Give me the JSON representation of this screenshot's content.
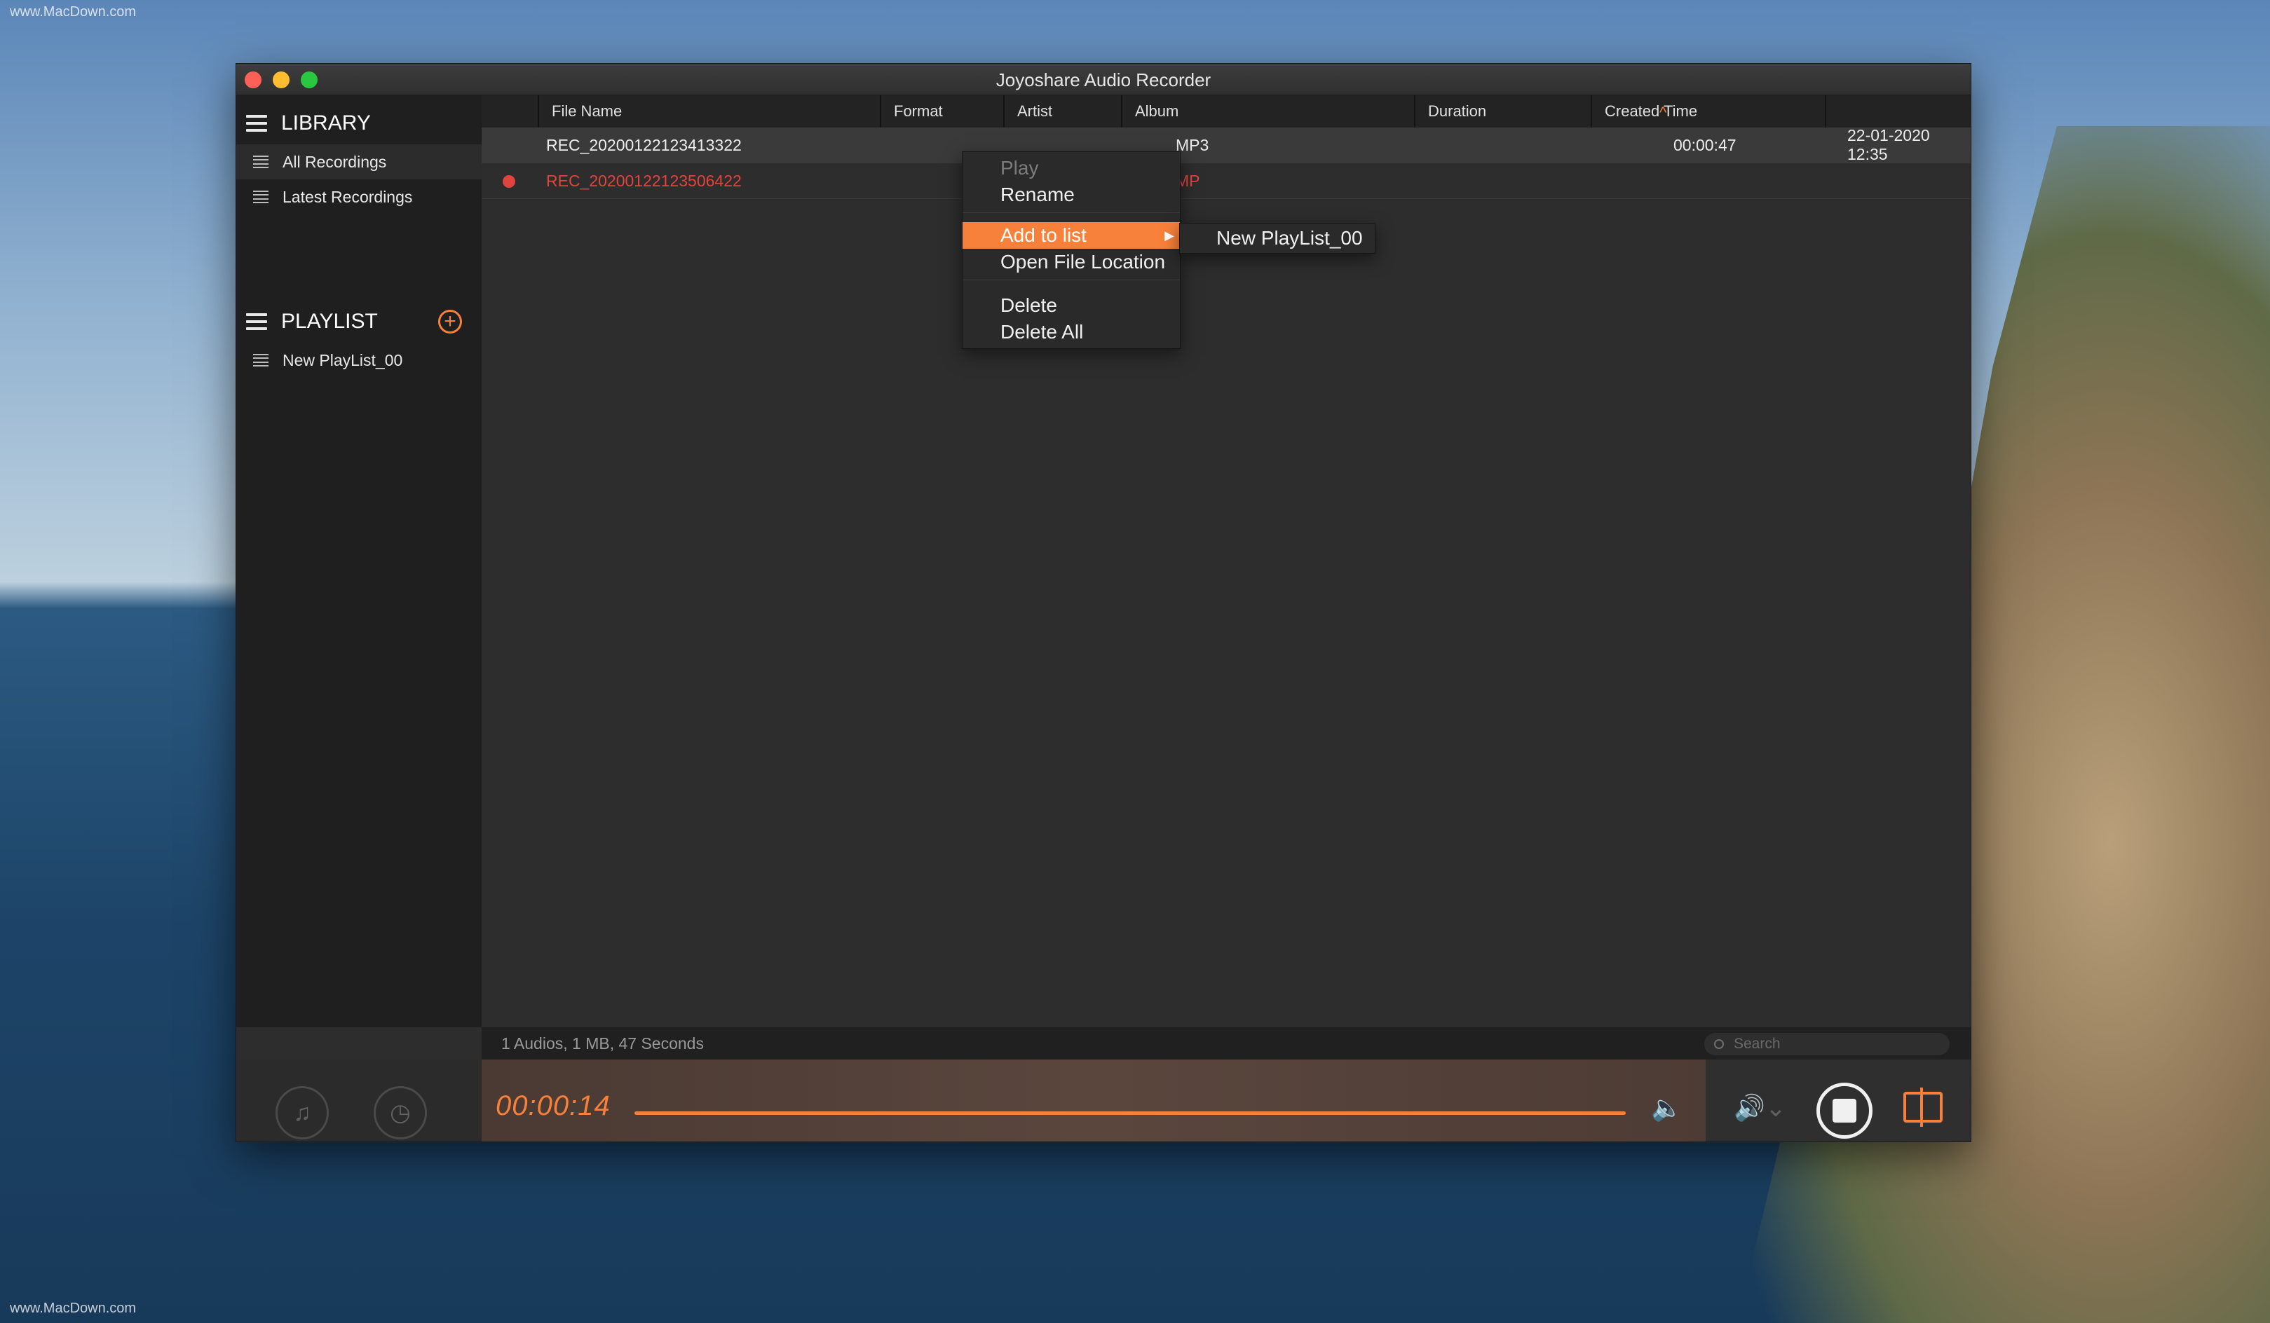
{
  "watermark": {
    "text": "www.MacDown.com"
  },
  "window": {
    "title": "Joyoshare Audio Recorder"
  },
  "sidebar": {
    "library_label": "LIBRARY",
    "library_items": [
      {
        "label": "All Recordings"
      },
      {
        "label": "Latest Recordings"
      }
    ],
    "playlist_label": "PLAYLIST",
    "playlist_items": [
      {
        "label": "New PlayList_00"
      }
    ]
  },
  "table": {
    "columns": [
      "File Name",
      "Format",
      "Artist",
      "Album",
      "Duration",
      "Created Time"
    ],
    "sort_column": "Album",
    "rows": [
      {
        "file_name": "REC_20200122123413322",
        "format": "MP3",
        "artist": "",
        "album": "",
        "duration": "00:00:47",
        "created": "22-01-2020 12:35",
        "recording": false
      },
      {
        "file_name": "REC_20200122123506422",
        "format": "MP",
        "artist": "",
        "album": "",
        "duration": "",
        "created": "",
        "recording": true
      }
    ]
  },
  "context_menu": {
    "items": [
      {
        "label": "Play",
        "disabled": true
      },
      {
        "label": "Rename"
      },
      {
        "label": "Add to list",
        "highlighted": true,
        "submenu": true
      },
      {
        "label": "Open File Location"
      },
      {
        "label": "Delete"
      },
      {
        "label": "Delete All"
      }
    ],
    "submenu_items": [
      "New PlayList_00"
    ]
  },
  "status": {
    "summary": "1 Audios, 1 MB, 47 Seconds"
  },
  "search": {
    "placeholder": "Search"
  },
  "player": {
    "timer": "00:00:14",
    "progress": 1.0,
    "icons": [
      "music-library-icon",
      "alarm-clock-icon",
      "volume-icon",
      "speaker-icon",
      "stop-icon",
      "split-icon"
    ]
  },
  "colors": {
    "accent": "#f7813a",
    "recording": "#e0443d",
    "background": "#2d2d2d"
  }
}
